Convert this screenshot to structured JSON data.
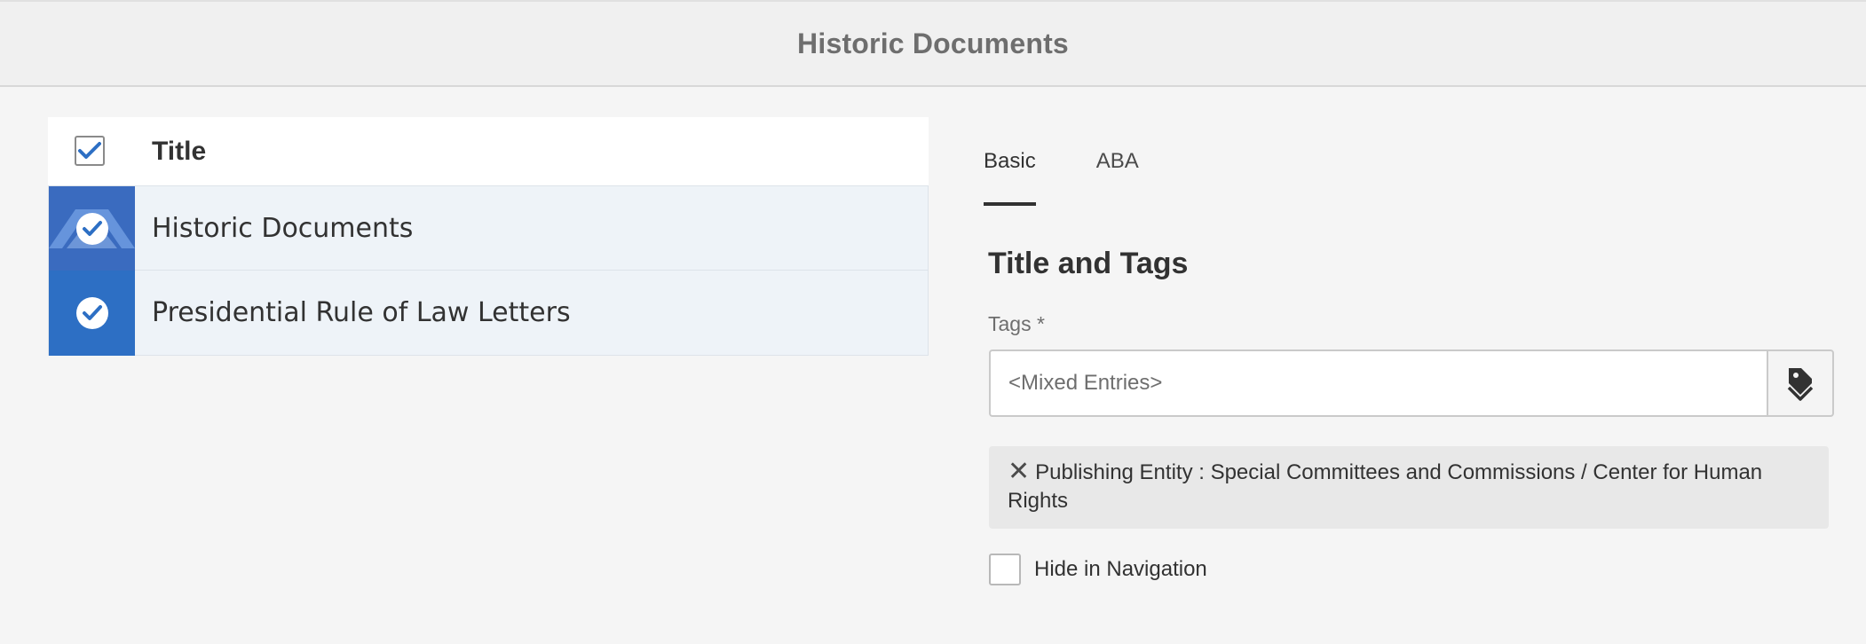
{
  "header": {
    "title": "Historic Documents"
  },
  "list": {
    "column_title": "Title",
    "rows": [
      {
        "label": "Historic Documents",
        "thumbnail": "organization-logo",
        "selected": true
      },
      {
        "label": "Presidential Rule of Law Letters",
        "thumbnail": "blue-tile",
        "selected": true
      }
    ]
  },
  "tabs": [
    {
      "label": "Basic",
      "active": true
    },
    {
      "label": "ABA",
      "active": false
    }
  ],
  "form": {
    "section_title": "Title and Tags",
    "tags_label": "Tags *",
    "tags_placeholder": "<Mixed Entries>",
    "tags_button_icon": "tag-icon",
    "tag_chip_text": "Publishing Entity : Special Committees and Commissions / Center for Human Rights",
    "hide_nav_label": "Hide in Navigation",
    "hide_nav_checked": false
  },
  "colors": {
    "accent": "#2d6fc4",
    "row_selected_bg": "#eef3f8",
    "chip_bg": "#e8e8e8"
  }
}
